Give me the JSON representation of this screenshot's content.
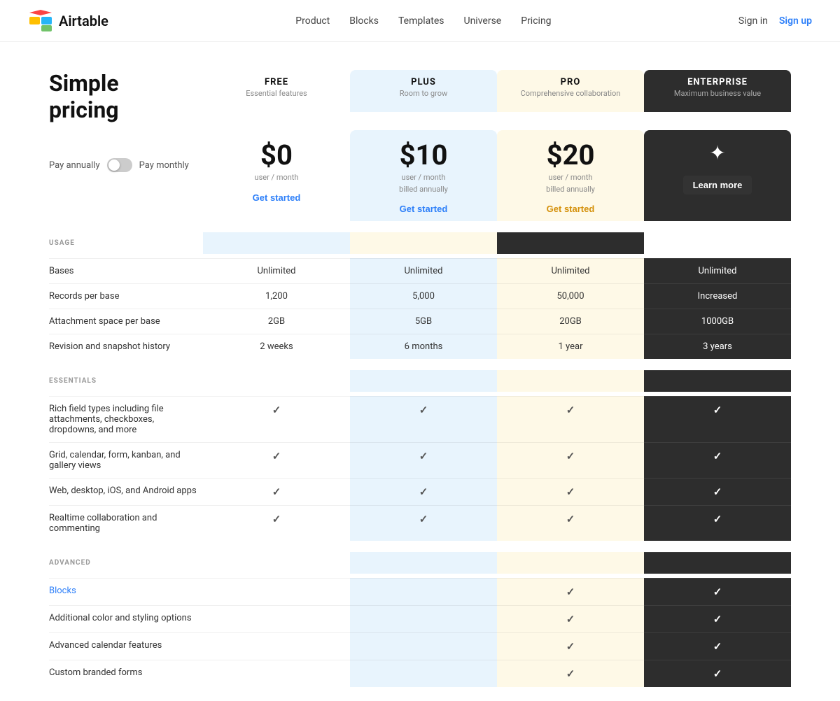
{
  "nav": {
    "logo_text": "Airtable",
    "links": [
      "Product",
      "Blocks",
      "Templates",
      "Universe",
      "Pricing"
    ],
    "signin": "Sign in",
    "signup": "Sign up"
  },
  "page": {
    "title": "Simple pricing",
    "billing_toggle": {
      "pay_annually": "Pay annually",
      "pay_monthly": "Pay monthly"
    }
  },
  "plans": {
    "free": {
      "name": "FREE",
      "tagline": "Essential features",
      "price": "$0",
      "price_sub": "user / month",
      "cta": "Get started"
    },
    "plus": {
      "name": "PLUS",
      "tagline": "Room to grow",
      "price": "$10",
      "price_sub1": "user / month",
      "price_sub2": "billed annually",
      "cta": "Get started"
    },
    "pro": {
      "name": "PRO",
      "tagline": "Comprehensive collaboration",
      "price": "$20",
      "price_sub1": "user / month",
      "price_sub2": "billed annually",
      "cta": "Get started"
    },
    "enterprise": {
      "name": "ENTERPRISE",
      "tagline": "Maximum business value",
      "cta": "Learn more"
    }
  },
  "sections": {
    "usage": {
      "label": "USAGE",
      "rows": [
        {
          "feature": "Bases",
          "free": "Unlimited",
          "plus": "Unlimited",
          "pro": "Unlimited",
          "enterprise": "Unlimited"
        },
        {
          "feature": "Records per base",
          "free": "1,200",
          "plus": "5,000",
          "pro": "50,000",
          "enterprise": "Increased"
        },
        {
          "feature": "Attachment space per base",
          "free": "2GB",
          "plus": "5GB",
          "pro": "20GB",
          "enterprise": "1000GB"
        },
        {
          "feature": "Revision and snapshot history",
          "free": "2 weeks",
          "plus": "6 months",
          "pro": "1 year",
          "enterprise": "3 years"
        }
      ]
    },
    "essentials": {
      "label": "ESSENTIALS",
      "rows": [
        {
          "feature": "Rich field types including file attachments, checkboxes, dropdowns, and more",
          "free": true,
          "plus": true,
          "pro": true,
          "enterprise": true
        },
        {
          "feature": "Grid, calendar, form, kanban, and gallery views",
          "free": true,
          "plus": true,
          "pro": true,
          "enterprise": true
        },
        {
          "feature": "Web, desktop, iOS, and Android apps",
          "free": true,
          "plus": true,
          "pro": true,
          "enterprise": true
        },
        {
          "feature": "Realtime collaboration and commenting",
          "free": true,
          "plus": true,
          "pro": true,
          "enterprise": true
        }
      ]
    },
    "advanced": {
      "label": "ADVANCED",
      "rows": [
        {
          "feature": "Blocks",
          "free": false,
          "plus": false,
          "pro": true,
          "enterprise": true
        },
        {
          "feature": "Additional color and styling options",
          "free": false,
          "plus": false,
          "pro": true,
          "enterprise": true
        },
        {
          "feature": "Advanced calendar features",
          "free": false,
          "plus": false,
          "pro": true,
          "enterprise": true
        },
        {
          "feature": "Custom branded forms",
          "free": false,
          "plus": false,
          "pro": true,
          "enterprise": true
        }
      ]
    }
  }
}
